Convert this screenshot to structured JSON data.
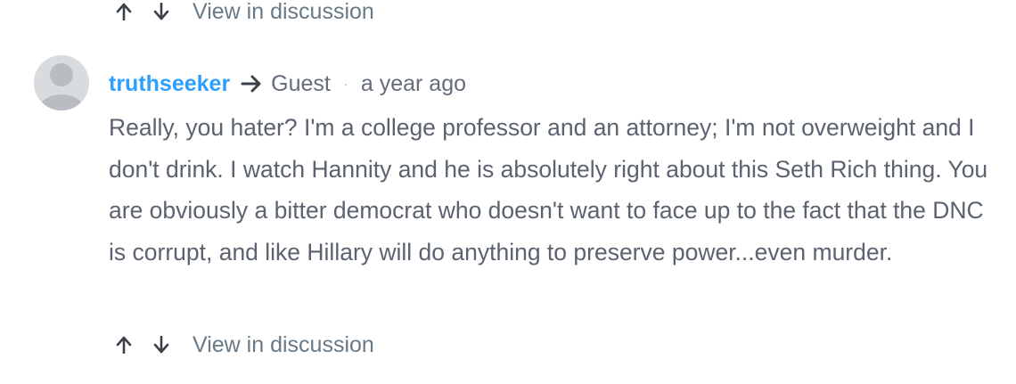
{
  "previous_comment": {
    "upvote_icon": "arrow-up-icon",
    "downvote_icon": "arrow-down-icon",
    "view_link": "View in discussion"
  },
  "comment": {
    "avatar_icon": "default-user-avatar",
    "author": "truthseeker",
    "reply_icon": "reply-arrow-icon",
    "reply_to": "Guest",
    "separator": "·",
    "timestamp": "a year ago",
    "text": "Really, you hater? I'm a college professor and an attorney; I'm not overweight and I don't drink. I watch Hannity and he is absolutely right about this Seth Rich thing. You are obviously a bitter democrat who doesn't want to face up to the fact that the DNC is corrupt, and like Hillary will do anything to preserve power...even murder.",
    "upvote_icon": "arrow-up-icon",
    "downvote_icon": "arrow-down-icon",
    "view_link": "View in discussion"
  },
  "colors": {
    "author_link": "#2e9fff",
    "body_text": "#5c6370",
    "meta_text": "#656c7a",
    "avatar_bg": "#d9dcdf"
  }
}
